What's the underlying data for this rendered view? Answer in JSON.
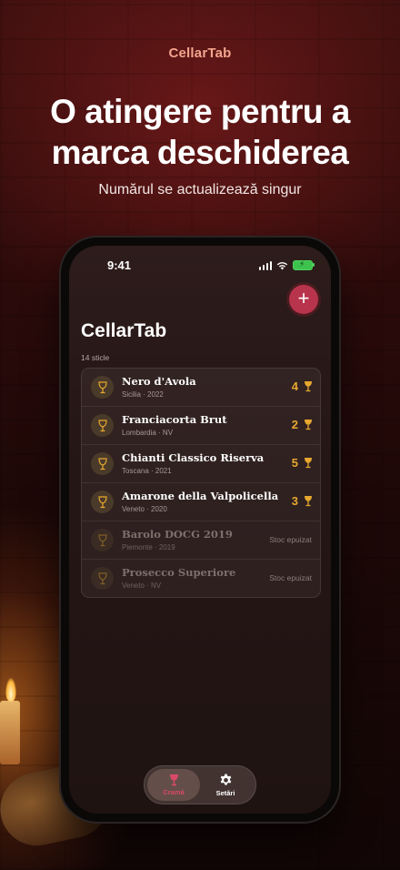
{
  "brand": "CellarTab",
  "headline_line1": "O atingere pentru a",
  "headline_line2": "marca deschiderea",
  "subheadline": "Numărul se actualizează singur",
  "status_bar": {
    "time": "9:41"
  },
  "app": {
    "title": "CellarTab",
    "bottle_count": "14 sticle",
    "add_button_label": "+",
    "wines": [
      {
        "name": "Nero d'Avola",
        "meta": "Sicilia · 2022",
        "qty": "4",
        "out_of_stock": false
      },
      {
        "name": "Franciacorta Brut",
        "meta": "Lombardia · NV",
        "qty": "2",
        "out_of_stock": false
      },
      {
        "name": "Chianti Classico Riserva",
        "meta": "Toscana · 2021",
        "qty": "5",
        "out_of_stock": false
      },
      {
        "name": "Amarone della Valpolicella",
        "meta": "Veneto · 2020",
        "qty": "3",
        "out_of_stock": false
      },
      {
        "name": "Barolo DOCG 2019",
        "meta": "Piemonte · 2019",
        "status": "Stoc epuizat",
        "out_of_stock": true
      },
      {
        "name": "Prosecco Superiore",
        "meta": "Veneto · NV",
        "status": "Stoc epuizat",
        "out_of_stock": true
      }
    ],
    "tabs": [
      {
        "label": "Cramă",
        "icon": "wine-glass-icon",
        "active": true
      },
      {
        "label": "Setări",
        "icon": "gear-icon",
        "active": false
      }
    ]
  },
  "colors": {
    "brand_accent": "#f3a48d",
    "add_button": "#b8344c",
    "quantity": "#e7a82f",
    "active_tab": "#d94a67"
  }
}
